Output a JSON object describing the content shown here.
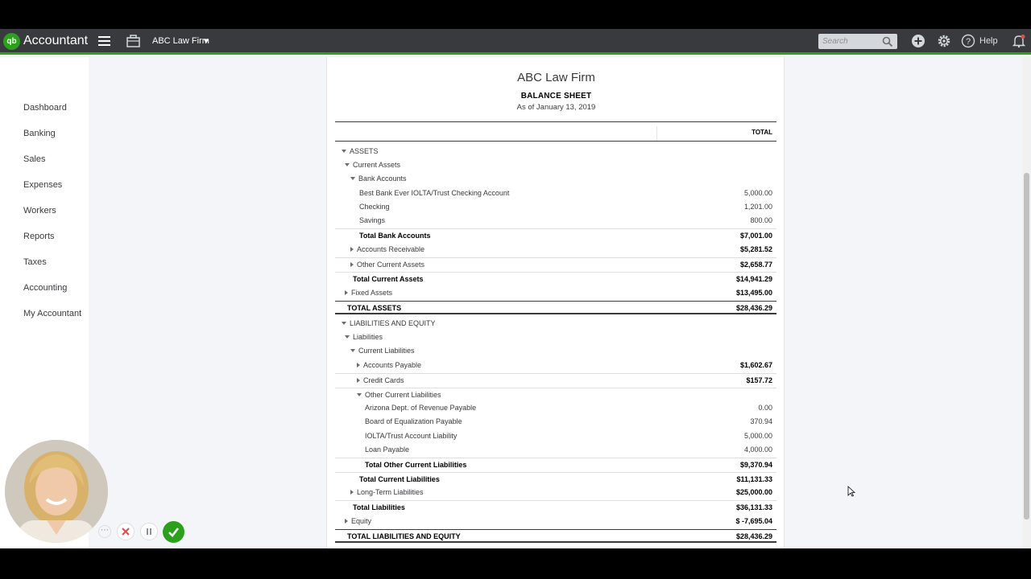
{
  "topbar": {
    "logo_text": "qb",
    "brand": "Accountant",
    "company": "ABC Law Firm",
    "search_placeholder": "Search",
    "help_label": "Help",
    "accent_color": "#2ca01c"
  },
  "sidebar": {
    "items": [
      {
        "label": "Dashboard"
      },
      {
        "label": "Banking"
      },
      {
        "label": "Sales"
      },
      {
        "label": "Expenses"
      },
      {
        "label": "Workers"
      },
      {
        "label": "Reports"
      },
      {
        "label": "Taxes"
      },
      {
        "label": "Accounting"
      },
      {
        "label": "My Accountant"
      }
    ]
  },
  "report": {
    "company": "ABC Law Firm",
    "title": "BALANCE SHEET",
    "date": "As of January 13, 2019",
    "column_header": "TOTAL",
    "rows": [
      {
        "label": "ASSETS",
        "amount": "",
        "level": 0,
        "toggle": "down"
      },
      {
        "label": "Current Assets",
        "amount": "",
        "level": 1,
        "toggle": "down"
      },
      {
        "label": "Bank Accounts",
        "amount": "",
        "level": 2,
        "toggle": "down"
      },
      {
        "label": "Best Bank Ever IOLTA/Trust Checking Account",
        "amount": "5,000.00",
        "level": 3
      },
      {
        "label": "Checking",
        "amount": "1,201.00",
        "level": 3
      },
      {
        "label": "Savings",
        "amount": "800.00",
        "level": 3
      },
      {
        "label": "Total Bank Accounts",
        "amount": "$7,001.00",
        "level": 3,
        "bold": true,
        "border": "light"
      },
      {
        "label": "Accounts Receivable",
        "amount": "$5,281.52",
        "level": 2,
        "toggle": "right",
        "bold_amount": true
      },
      {
        "label": "Other Current Assets",
        "amount": "$2,658.77",
        "level": 2,
        "toggle": "right",
        "bold_amount": true,
        "border": "light"
      },
      {
        "label": "Total Current Assets",
        "amount": "$14,941.29",
        "level": 2,
        "bold": true,
        "border": "light"
      },
      {
        "label": "Fixed Assets",
        "amount": "$13,495.00",
        "level": 1,
        "toggle": "right",
        "bold_amount": true
      },
      {
        "label": "TOTAL ASSETS",
        "amount": "$28,436.29",
        "level": 1,
        "bold": true,
        "border": "dark",
        "bottom": true
      },
      {
        "label": "LIABILITIES AND EQUITY",
        "amount": "",
        "level": 0,
        "toggle": "down"
      },
      {
        "label": "Liabilities",
        "amount": "",
        "level": 1,
        "toggle": "down"
      },
      {
        "label": "Current Liabilities",
        "amount": "",
        "level": 2,
        "toggle": "down"
      },
      {
        "label": "Accounts Payable",
        "amount": "$1,602.67",
        "level": 3,
        "toggle": "right",
        "bold_amount": true
      },
      {
        "label": "Credit Cards",
        "amount": "$157.72",
        "level": 3,
        "toggle": "right",
        "bold_amount": true,
        "border": "light"
      },
      {
        "label": "Other Current Liabilities",
        "amount": "",
        "level": 3,
        "toggle": "down",
        "border": "light"
      },
      {
        "label": "Arizona Dept. of Revenue Payable",
        "amount": "0.00",
        "level": 4
      },
      {
        "label": "Board of Equalization Payable",
        "amount": "370.94",
        "level": 4
      },
      {
        "label": "IOLTA/Trust Account Liability",
        "amount": "5,000.00",
        "level": 4
      },
      {
        "label": "Loan Payable",
        "amount": "4,000.00",
        "level": 4
      },
      {
        "label": "Total Other Current Liabilities",
        "amount": "$9,370.94",
        "level": 4,
        "bold": true,
        "border": "light"
      },
      {
        "label": "Total Current Liabilities",
        "amount": "$11,131.33",
        "level": 3,
        "bold": true,
        "border": "light"
      },
      {
        "label": "Long-Term Liabilities",
        "amount": "$25,000.00",
        "level": 2,
        "toggle": "right",
        "bold_amount": true
      },
      {
        "label": "Total Liabilities",
        "amount": "$36,131.33",
        "level": 2,
        "bold": true,
        "border": "light"
      },
      {
        "label": "Equity",
        "amount": "$ -7,695.04",
        "level": 1,
        "toggle": "right",
        "bold_amount": true
      },
      {
        "label": "TOTAL LIABILITIES AND EQUITY",
        "amount": "$28,436.29",
        "level": 1,
        "bold": true,
        "border": "dark",
        "bottom": true
      }
    ]
  }
}
